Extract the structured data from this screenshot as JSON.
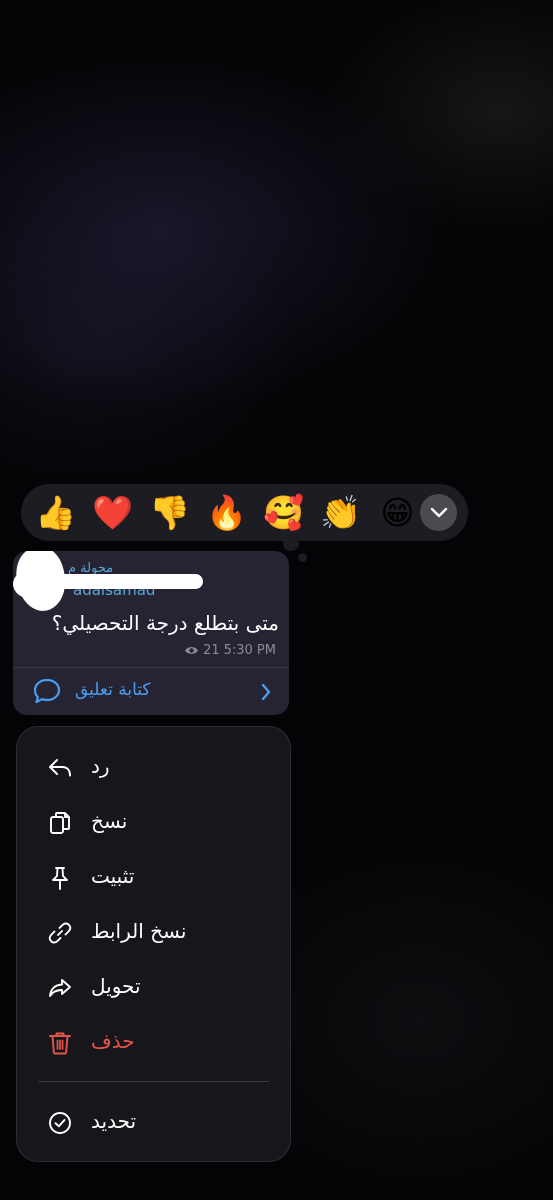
{
  "reactions": [
    {
      "emoji": "👍",
      "name": "thumbs-up"
    },
    {
      "emoji": "❤️",
      "name": "red-heart"
    },
    {
      "emoji": "👎",
      "name": "thumbs-down"
    },
    {
      "emoji": "🔥",
      "name": "fire"
    },
    {
      "emoji": "🥰",
      "name": "smiling-face-with-hearts"
    },
    {
      "emoji": "👏",
      "name": "clapping-hands"
    },
    {
      "emoji": "😁",
      "name": "beaming-face"
    }
  ],
  "message": {
    "forwarded_label": "محولة م",
    "forwarded_from": "adalsamad",
    "text": "متى بتطلع درجة التحصيلي؟",
    "views": "21",
    "time": "5:30 PM",
    "comment_label": "كتابة تعليق"
  },
  "menu": {
    "items": [
      {
        "label": "رد",
        "icon": "reply-icon"
      },
      {
        "label": "نسخ",
        "icon": "copy-icon"
      },
      {
        "label": "تثبيت",
        "icon": "pin-icon"
      },
      {
        "label": "نسخ الرابط",
        "icon": "link-icon"
      },
      {
        "label": "تحويل",
        "icon": "forward-icon"
      },
      {
        "label": "حذف",
        "icon": "trash-icon"
      }
    ],
    "select_label": "تحديد"
  },
  "colors": {
    "accent_blue": "#4c9cf0",
    "forward_name": "#57a7d8",
    "danger": "#e5534b",
    "menu_bg": "#17171b",
    "bubble_bg": "#262433"
  }
}
